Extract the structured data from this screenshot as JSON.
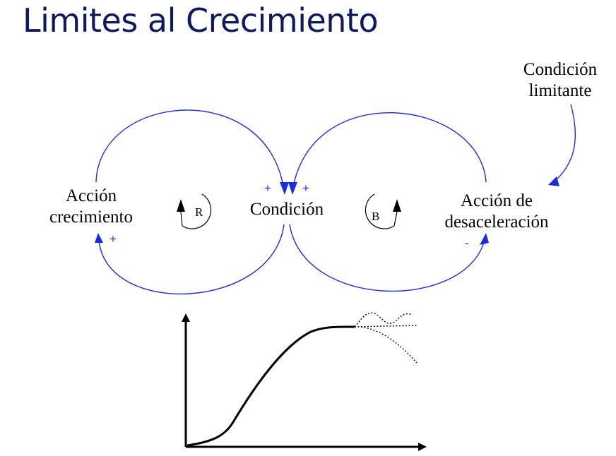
{
  "slide": {
    "title": "Limites al Crecimiento"
  },
  "diagram": {
    "nodes": {
      "accion_crecimiento": [
        "Acción",
        "crecimiento"
      ],
      "condicion": "Condición",
      "accion_desaceleracion": [
        "Acción de",
        "desaceleración"
      ],
      "condicion_limitante": [
        "Condición",
        "limitante"
      ]
    },
    "loops": {
      "reinforcing": "R",
      "balancing": "B"
    },
    "polarities": {
      "left_to_condicion": "+",
      "right_to_condicion": "+",
      "condicion_to_accion_crecimiento": "+",
      "condicion_to_accion_desaceleracion": "-"
    },
    "colors": {
      "link": "#1a2be0",
      "title": "#0e1a5e",
      "curve": "#000000"
    }
  },
  "behavior_graph": {
    "description_icon": "s-curve-graph"
  }
}
